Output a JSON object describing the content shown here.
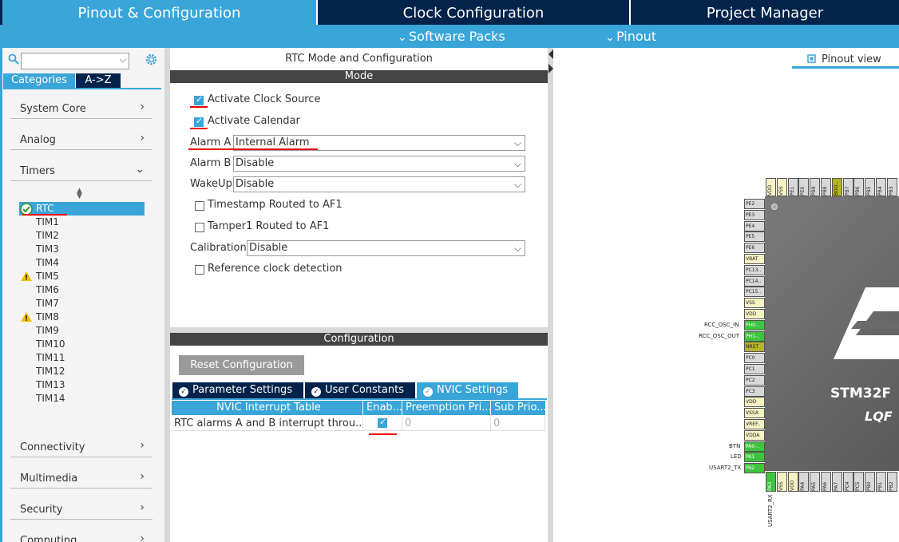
{
  "top_tabs": [
    "Pinout & Configuration",
    "Clock Configuration",
    "Project Manager"
  ],
  "submenu": {
    "software_packs": "Software Packs",
    "pinout": "Pinout"
  },
  "left": {
    "cat_tab_categories": "Categories",
    "cat_tab_az": "A->Z",
    "categories": [
      "System Core",
      "Analog",
      "Timers",
      "Connectivity",
      "Multimedia",
      "Security",
      "Computing"
    ],
    "timers": [
      "RTC",
      "TIM1",
      "TIM2",
      "TIM3",
      "TIM4",
      "TIM5",
      "TIM6",
      "TIM7",
      "TIM8",
      "TIM9",
      "TIM10",
      "TIM11",
      "TIM12",
      "TIM13",
      "TIM14"
    ]
  },
  "mode": {
    "title": "RTC Mode and Configuration",
    "bar": "Mode",
    "activate_clock": "Activate Clock Source",
    "activate_calendar": "Activate Calendar",
    "alarm_a_label": "Alarm A",
    "alarm_a_value": "Internal Alarm",
    "alarm_b_label": "Alarm B",
    "alarm_b_value": "Disable",
    "wakeup_label": "WakeUp",
    "wakeup_value": "Disable",
    "timestamp": "Timestamp Routed to AF1",
    "tamper": "Tamper1 Routed to AF1",
    "calibration_label": "Calibration",
    "calibration_value": "Disable",
    "refclock": "Reference clock detection"
  },
  "config": {
    "bar": "Configuration",
    "reset": "Reset Configuration",
    "tabs": [
      "Parameter Settings",
      "User Constants",
      "NVIC Settings"
    ],
    "columns": [
      "NVIC Interrupt Table",
      "Enab...",
      "Preemption Pri...",
      "Sub Prio..."
    ],
    "row": {
      "name": "RTC alarms A and B interrupt throu...",
      "pre": "0",
      "sub": "0"
    }
  },
  "pinout": {
    "view_label": "Pinout view",
    "chip_name": "STM32F",
    "chip_pkg": "LQF",
    "left_pins": [
      "PE2",
      "PE3",
      "PE4",
      "PE5",
      "PE6",
      "VBAT",
      "PC13..",
      "PC14..",
      "PC15..",
      "VSS",
      "VDD",
      "PH0-..",
      "PH1-..",
      "NRST",
      "PC0",
      "PC1",
      "PC2",
      "PC3",
      "VDD",
      "VSSA",
      "VREF..",
      "VDDA",
      "PA0-..",
      "PA1",
      "PA2"
    ],
    "top_pins": [
      "VDD",
      "VSS",
      "PE1",
      "PE0",
      "PB9",
      "PB8",
      "BOO..",
      "PB7",
      "PB6",
      "PB5",
      "PB4",
      "PB3"
    ],
    "bottom_pins": [
      "PA3",
      "VSS",
      "VDD",
      "PA4",
      "PA5",
      "PA6",
      "PA7",
      "PC4",
      "PC5",
      "PB0",
      "PB1",
      "PB2"
    ],
    "signals": {
      "osc_in": "RCC_OSC_IN",
      "osc_out": "RCC_OSC_OUT",
      "btn": "BTN",
      "led": "LED",
      "tx": "USART2_TX",
      "rx": "USART2_RX"
    }
  }
}
